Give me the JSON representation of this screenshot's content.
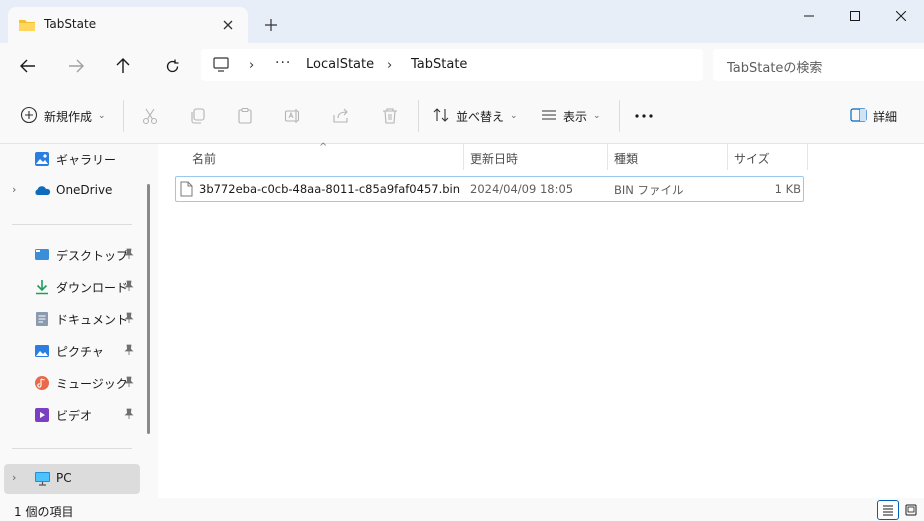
{
  "window": {
    "tab_title": "TabState",
    "tab_icon": "folder-icon",
    "colors": {
      "accent": "#0067c0",
      "titlebar": "#e7eef8",
      "surface": "#f9f9f9"
    }
  },
  "address": {
    "breadcrumbs": [
      "LocalState",
      "TabState"
    ],
    "search_placeholder": "TabStateの検索"
  },
  "commandbar": {
    "new_label": "新規作成",
    "sort_label": "並べ替え",
    "view_label": "表示",
    "details_label": "詳細"
  },
  "nav": {
    "items": [
      {
        "label": "ギャラリー",
        "icon": "gallery-icon"
      },
      {
        "label": "OneDrive",
        "icon": "onedrive-icon"
      },
      {
        "label": "デスクトップ",
        "icon": "desktop-icon"
      },
      {
        "label": "ダウンロード",
        "icon": "download-icon"
      },
      {
        "label": "ドキュメント",
        "icon": "documents-icon"
      },
      {
        "label": "ピクチャ",
        "icon": "pictures-icon"
      },
      {
        "label": "ミュージック",
        "icon": "music-icon"
      },
      {
        "label": "ビデオ",
        "icon": "video-icon"
      },
      {
        "label": "PC",
        "icon": "pc-icon"
      }
    ]
  },
  "filelist": {
    "columns": [
      "名前",
      "更新日時",
      "種類",
      "サイズ"
    ],
    "rows": [
      {
        "name": "3b772eba-c0cb-48aa-8011-c85a9faf0457.bin",
        "modified": "2024/04/09 18:05",
        "type": "BIN ファイル",
        "size": "1 KB"
      }
    ]
  },
  "status": {
    "item_count": "1 個の項目"
  }
}
